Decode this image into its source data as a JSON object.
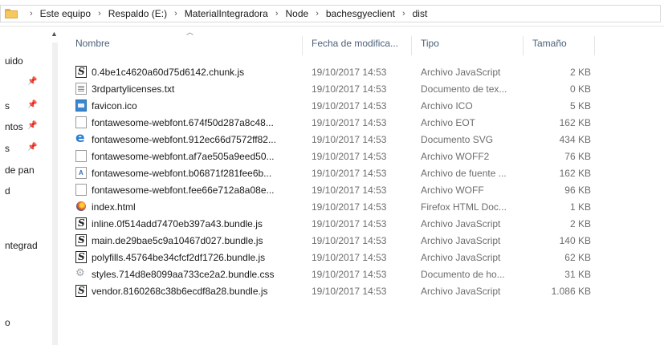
{
  "address_bar": {
    "crumbs": [
      "Este equipo",
      "Respaldo (E:)",
      "MaterialIntegradora",
      "Node",
      "bachesgyeclient",
      "dist"
    ]
  },
  "nav_pane": {
    "items": [
      "uido",
      "s",
      "ntos",
      "s",
      "de pan",
      "d",
      "ntegrad",
      "o"
    ]
  },
  "columns": {
    "name": "Nombre",
    "date": "Fecha de modifica...",
    "type": "Tipo",
    "size": "Tamaño"
  },
  "files": [
    {
      "name": "0.4be1c4620a60d75d6142.chunk.js",
      "date": "19/10/2017 14:53",
      "type": "Archivo JavaScript",
      "size": "2 KB",
      "icon": "javascript-file-icon"
    },
    {
      "name": "3rdpartylicenses.txt",
      "date": "19/10/2017 14:53",
      "type": "Documento de tex...",
      "size": "0 KB",
      "icon": "text-file-icon"
    },
    {
      "name": "favicon.ico",
      "date": "19/10/2017 14:53",
      "type": "Archivo ICO",
      "size": "5 KB",
      "icon": "image-file-icon"
    },
    {
      "name": "fontawesome-webfont.674f50d287a8c48...",
      "date": "19/10/2017 14:53",
      "type": "Archivo EOT",
      "size": "162 KB",
      "icon": "blank-file-icon"
    },
    {
      "name": "fontawesome-webfont.912ec66d7572ff82...",
      "date": "19/10/2017 14:53",
      "type": "Documento SVG",
      "size": "434 KB",
      "icon": "internet-explorer-icon"
    },
    {
      "name": "fontawesome-webfont.af7ae505a9eed50...",
      "date": "19/10/2017 14:53",
      "type": "Archivo WOFF2",
      "size": "76 KB",
      "icon": "blank-file-icon"
    },
    {
      "name": "fontawesome-webfont.b06871f281fee6b...",
      "date": "19/10/2017 14:53",
      "type": "Archivo de fuente ...",
      "size": "162 KB",
      "icon": "font-file-icon"
    },
    {
      "name": "fontawesome-webfont.fee66e712a8a08e...",
      "date": "19/10/2017 14:53",
      "type": "Archivo WOFF",
      "size": "96 KB",
      "icon": "blank-file-icon"
    },
    {
      "name": "index.html",
      "date": "19/10/2017 14:53",
      "type": "Firefox HTML Doc...",
      "size": "1 KB",
      "icon": "firefox-icon"
    },
    {
      "name": "inline.0f514add7470eb397a43.bundle.js",
      "date": "19/10/2017 14:53",
      "type": "Archivo JavaScript",
      "size": "2 KB",
      "icon": "javascript-file-icon"
    },
    {
      "name": "main.de29bae5c9a10467d027.bundle.js",
      "date": "19/10/2017 14:53",
      "type": "Archivo JavaScript",
      "size": "140 KB",
      "icon": "javascript-file-icon"
    },
    {
      "name": "polyfills.45764be34cfcf2df1726.bundle.js",
      "date": "19/10/2017 14:53",
      "type": "Archivo JavaScript",
      "size": "62 KB",
      "icon": "javascript-file-icon"
    },
    {
      "name": "styles.714d8e8099aa733ce2a2.bundle.css",
      "date": "19/10/2017 14:53",
      "type": "Documento de ho...",
      "size": "31 KB",
      "icon": "stylesheet-file-icon"
    },
    {
      "name": "vendor.8160268c38b6ecdf8a28.bundle.js",
      "date": "19/10/2017 14:53",
      "type": "Archivo JavaScript",
      "size": "1.086 KB",
      "icon": "javascript-file-icon"
    }
  ]
}
